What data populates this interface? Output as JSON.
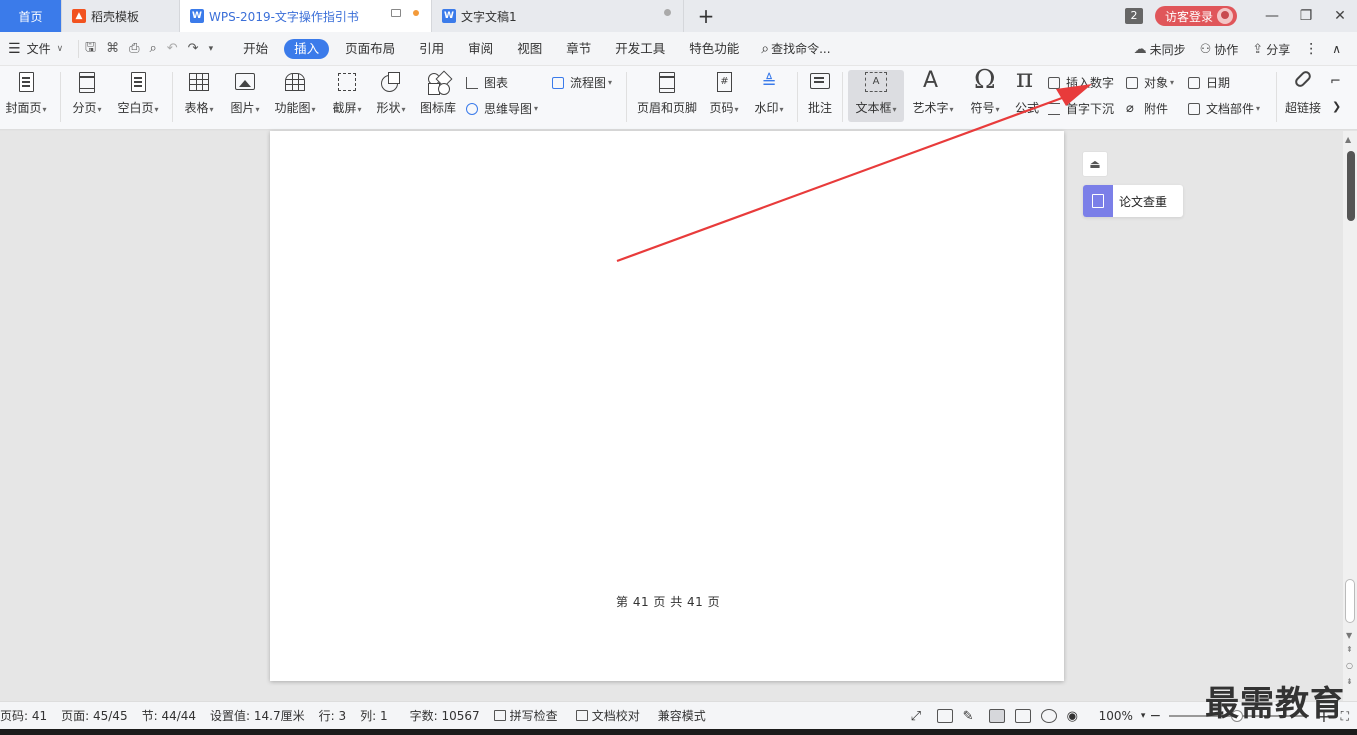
{
  "tabs": {
    "home": "首页",
    "template": "稻壳模板",
    "doc_active": "WPS-2019-文字操作指引书",
    "doc2": "文字文稿1",
    "add": "+",
    "window_count": "2",
    "login": "访客登录"
  },
  "menu": {
    "file": "文件",
    "tabs": [
      "开始",
      "插入",
      "页面布局",
      "引用",
      "审阅",
      "视图",
      "章节",
      "开发工具",
      "特色功能"
    ],
    "search": "查找命令...",
    "not_synced": "未同步",
    "collab": "协作",
    "share": "分享"
  },
  "ribbon": {
    "cover": "封面页",
    "page_break": "分页",
    "blank_page": "空白页",
    "table": "表格",
    "picture": "图片",
    "func_chart": "功能图",
    "screenshot": "截屏",
    "shape": "形状",
    "icon_lib": "图标库",
    "chart": "图表",
    "mindmap": "思维导图",
    "flowchart": "流程图",
    "header_footer": "页眉和页脚",
    "page_num": "页码",
    "watermark": "水印",
    "comment": "批注",
    "textbox": "文本框",
    "art_text": "艺术字",
    "symbol": "符号",
    "formula": "公式",
    "insert_number": "插入数字",
    "drop_cap": "首字下沉",
    "object": "对象",
    "attachment": "附件",
    "date": "日期",
    "doc_parts": "文档部件",
    "hyperlink": "超链接"
  },
  "page": {
    "footer_text": "第 41 页 共 41 页"
  },
  "side_panel": {
    "paper_check": "论文查重"
  },
  "status": {
    "page_code": "页码: 41",
    "page": "页面: 45/45",
    "section": "节: 44/44",
    "setting": "设置值: 14.7厘米",
    "row": "行: 3",
    "col": "列: 1",
    "word_count": "字数: 10567",
    "spell_check": "拼写检查",
    "doc_proof": "文档校对",
    "compat_mode": "兼容模式",
    "zoom": "100%"
  },
  "overlay": {
    "watermark": "最需教育",
    "arrow_color": "#e83b3b"
  }
}
